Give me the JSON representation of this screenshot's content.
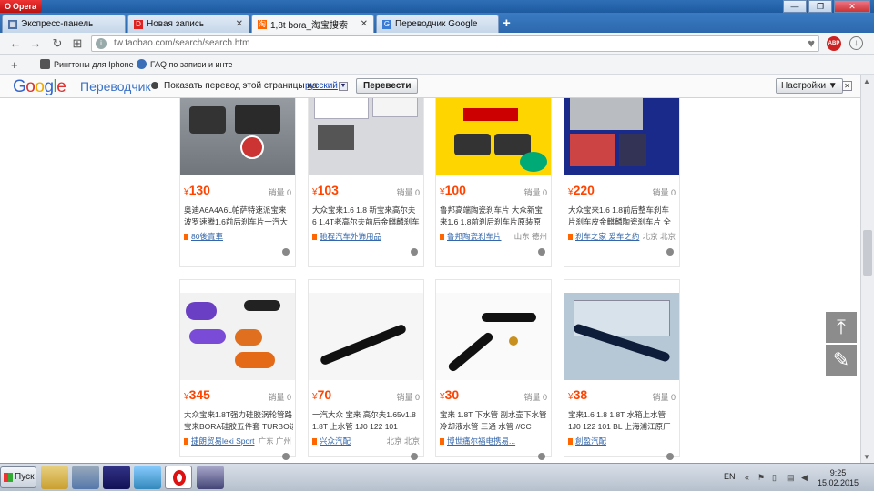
{
  "window": {
    "app_name": "Opera"
  },
  "tabs": [
    {
      "label": "Экспресс-панель",
      "icon": "grid-icon",
      "color": "#4a6fa5"
    },
    {
      "label": "Новая запись",
      "icon": "d-icon",
      "color": "#d22"
    },
    {
      "label": "1,8t bora_淘宝搜索",
      "icon": "taobao-icon",
      "color": "#ff6600"
    },
    {
      "label": "Переводчик Google",
      "icon": "translate-icon",
      "color": "#3b7bd8"
    }
  ],
  "address": {
    "url": "tw.taobao.com/search/search.htm",
    "abp_label": "ABP"
  },
  "bookmarks": [
    {
      "label": "Рингтоны для Iphone"
    },
    {
      "label": "FAQ по записи и инте"
    }
  ],
  "translate_bar": {
    "logo_google": "Google",
    "logo_sub": "Переводчик",
    "prompt": "Показать перевод этой страницы на",
    "language": "русский",
    "translate_button": "Перевести",
    "settings_button": "Настройки ▼"
  },
  "products": [
    {
      "price": "130",
      "sales": "销量 0",
      "title1": "奥迪A6A4A6L帕萨特速派宝来",
      "title2": "波罗速腾1.6前后刹车片一汽大",
      "shop": "80後賣車",
      "location": "",
      "img": "pads-grey"
    },
    {
      "price": "103",
      "sales": "销量 0",
      "title1": "大众宝来1.6 1.8 新宝来高尔夫",
      "title2": "6 1.4T老高尔夫前后金麒麟刹车",
      "shop": "驰程汽车外饰用品",
      "location": "",
      "img": "pads-box"
    },
    {
      "price": "100",
      "sales": "销量 0",
      "title1": "鲁邦高端陶瓷刹车片 大众新宝",
      "title2": "来1.6 1.8前刹后刹车片原装原",
      "shop": "鲁邦陶瓷刹车片",
      "location": "山东 德州",
      "img": "pads-yellow"
    },
    {
      "price": "220",
      "sales": "销量 0",
      "title1": "大众宝来1.6 1.8前后整车刹车",
      "title2": "片刹车皮金麒麟陶瓷刹车片 全",
      "shop": "刹车之家 爱车之约",
      "location": "北京 北京",
      "img": "pads-blue"
    },
    {
      "price": "345",
      "sales": "销量 0",
      "title1": "大众宝来1.8T强力硅胶涡轮管路",
      "title2": "宝来BORA硅胶五件套 TURBO进",
      "shop": "捷朗贸易lexi Sport",
      "location": "广东 广州",
      "img": "hoses-purple"
    },
    {
      "price": "70",
      "sales": "销量 0",
      "title1": "一汽大众 宝来 高尔夫1.65v1.8",
      "title2": "1.8T 上水管 1J0 122 101",
      "shop": "兴众汽配",
      "location": "北京 北京",
      "img": "hose-black"
    },
    {
      "price": "30",
      "sales": "销量 0",
      "title1": "宝来 1.8T 下水管 副水壶下水管",
      "title2": "冷却液水管 三通 水管 //CC",
      "shop": "博世痛尔福电携易...",
      "location": "",
      "img": "hose-coin"
    },
    {
      "price": "38",
      "sales": "销量 0",
      "title1": "宝来1.6 1.8 1.8T 水箱上水管",
      "title2": "1J0 122 101 BL 上海浦江原厂",
      "shop": "創盈汽配",
      "location": "",
      "img": "hose-box"
    }
  ],
  "price_currency": "¥",
  "taskbar": {
    "start_label": "Пуск",
    "language": "EN",
    "time": "9:25",
    "date": "15.02.2015"
  },
  "colors": {
    "price": "#ff4400",
    "link": "#3366aa",
    "accent": "#3366cc"
  }
}
